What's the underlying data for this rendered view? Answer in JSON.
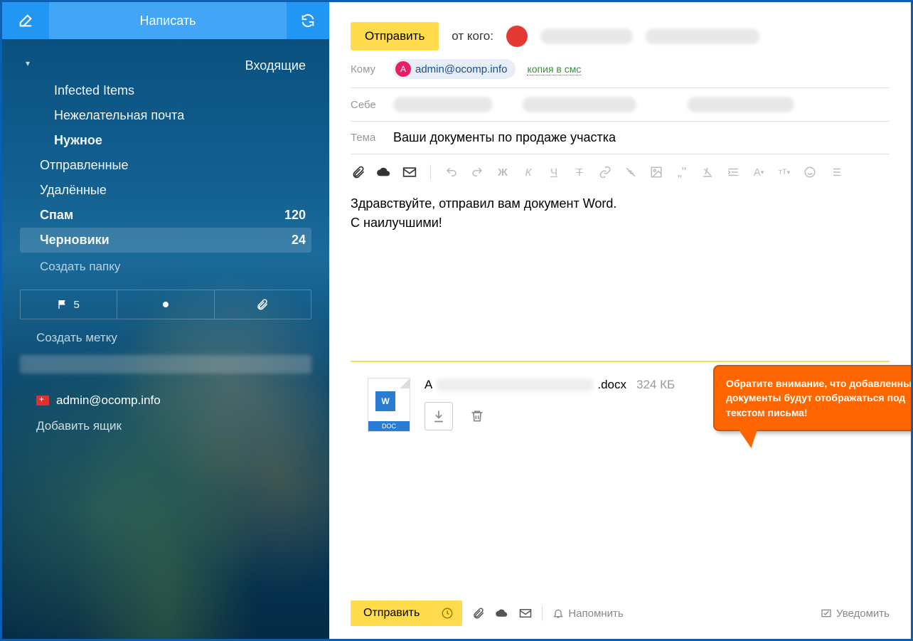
{
  "sidebar": {
    "compose_label": "Написать",
    "folders": [
      {
        "label": "Входящие",
        "type": "parent"
      },
      {
        "label": "Infected Items",
        "type": "child"
      },
      {
        "label": "Нежелательная почта",
        "type": "child"
      },
      {
        "label": "Нужное",
        "type": "child",
        "bold": true
      },
      {
        "label": "Отправленные",
        "type": "top"
      },
      {
        "label": "Удалённые",
        "type": "top"
      },
      {
        "label": "Спам",
        "type": "top",
        "count": "120",
        "bold": true
      },
      {
        "label": "Черновики",
        "type": "top",
        "count": "24",
        "bold": true,
        "active": true
      }
    ],
    "create_folder": "Создать папку",
    "flag_count": "5",
    "create_label": "Создать метку",
    "account": "admin@ocomp.info",
    "add_mailbox": "Добавить ящик"
  },
  "compose": {
    "send_top": "Отправить",
    "from_label": "от кого:",
    "to_label": "Кому",
    "recipient_initial": "А",
    "recipient_email": "admin@ocomp.info",
    "sms_copy": "копия в смс",
    "self_label": "Себе",
    "subject_label": "Тема",
    "subject_value": "Ваши документы по продаже участка",
    "body_line1": "Здравствуйте, отправил вам документ Word.",
    "body_line2": "С наилучшими!",
    "callout_text": "Обратите внимание, что добавленные документы будут отображаться под текстом письма!",
    "attachment": {
      "doc_badge": "W",
      "doc_footer": "DOC",
      "name_prefix": "А",
      "name_suffix": ".docx",
      "size": "324 КБ"
    },
    "bottom": {
      "send": "Отправить",
      "remind": "Напомнить",
      "notify": "Уведомить"
    }
  }
}
